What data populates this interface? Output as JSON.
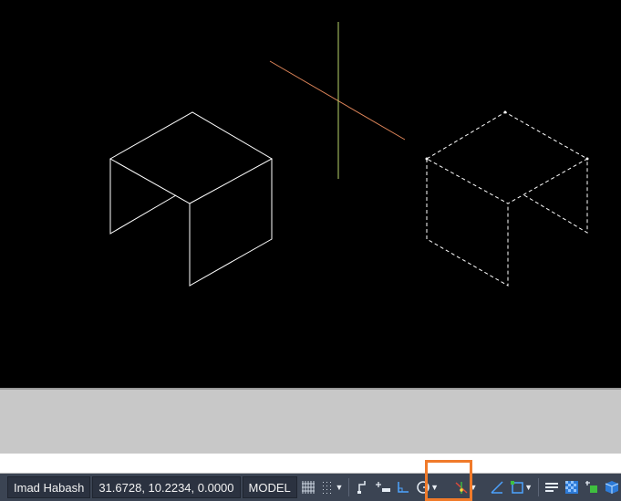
{
  "statusbar": {
    "user_name": "Imad Habash",
    "coordinates": "31.6728, 10.2234, 0.0000",
    "space_label": "MODEL",
    "buttons": [
      "grid-icon",
      "snap-icon",
      "infer-constraints-icon",
      "dynamic-input-icon",
      "ortho-icon",
      "polar-tracking-icon",
      "isometric-drafting-icon",
      "object-snap-tracking-icon",
      "object-snap-icon",
      "lineweight-icon",
      "transparency-icon",
      "selection-cycling-icon",
      "3d-object-snap-icon"
    ]
  },
  "colors": {
    "canvas": "#000000",
    "statusbar": "#3b4453",
    "highlight": "#f07a2a",
    "crosshair_x": "#e0865a",
    "crosshair_y": "#b7d36a",
    "geometry": "#ffffff"
  }
}
